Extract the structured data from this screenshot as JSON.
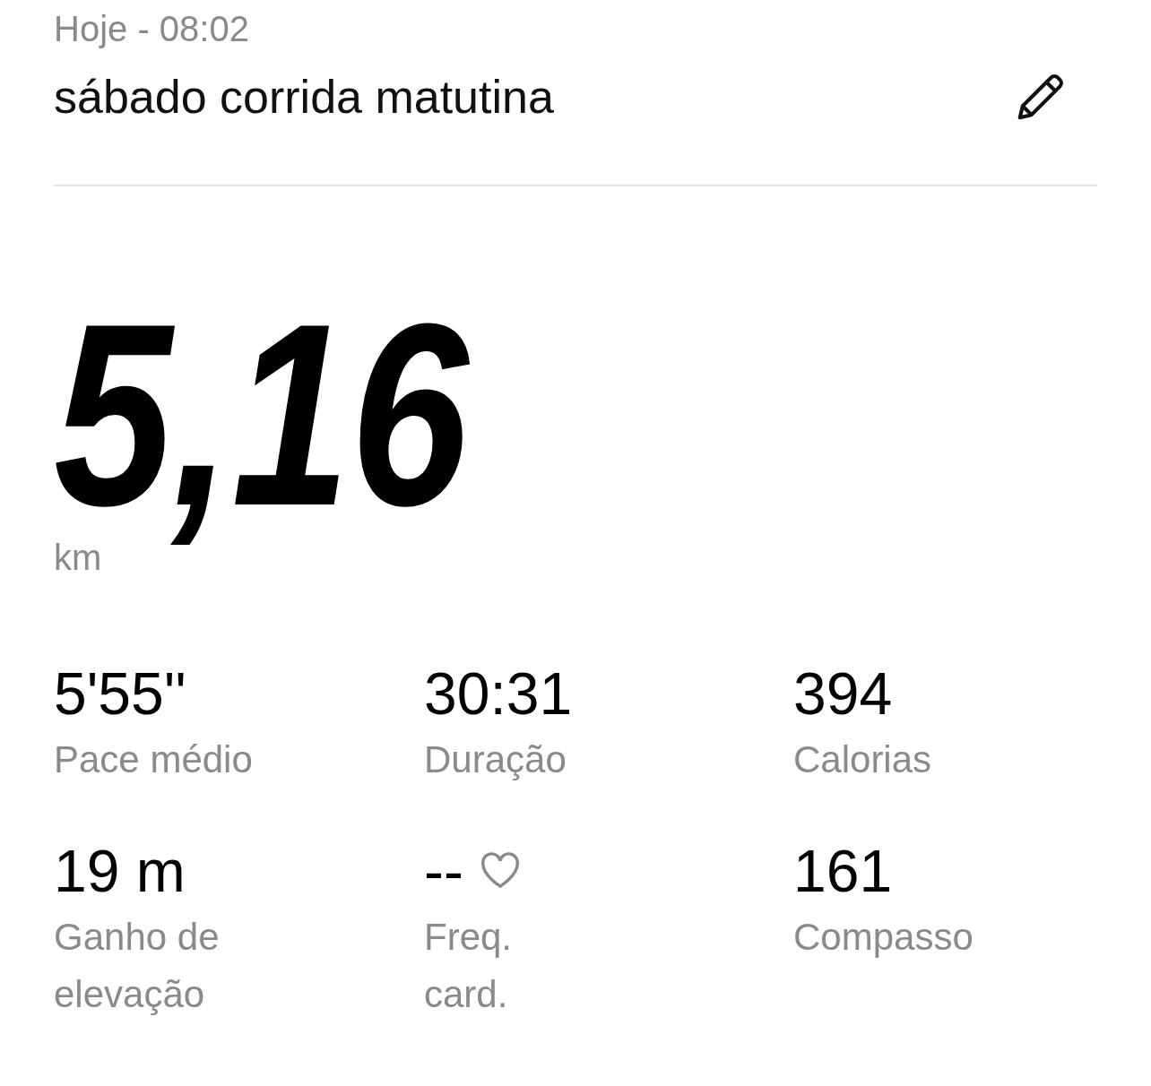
{
  "header": {
    "date": "Hoje - 08:02",
    "title": "sábado corrida matutina"
  },
  "distance": {
    "value": "5,16",
    "unit": "km"
  },
  "stats": [
    {
      "value": "5'55''",
      "label": "Pace médio",
      "kind": "plain"
    },
    {
      "value": "30:31",
      "label": "Duração",
      "kind": "plain"
    },
    {
      "value": "394",
      "label": "Calorias",
      "kind": "plain"
    },
    {
      "value": "19 m",
      "label": "Ganho de\nelevação",
      "kind": "plain"
    },
    {
      "value": "--",
      "label": "Freq.\ncard.",
      "kind": "heart"
    },
    {
      "value": "161",
      "label": "Compasso",
      "kind": "plain"
    }
  ]
}
